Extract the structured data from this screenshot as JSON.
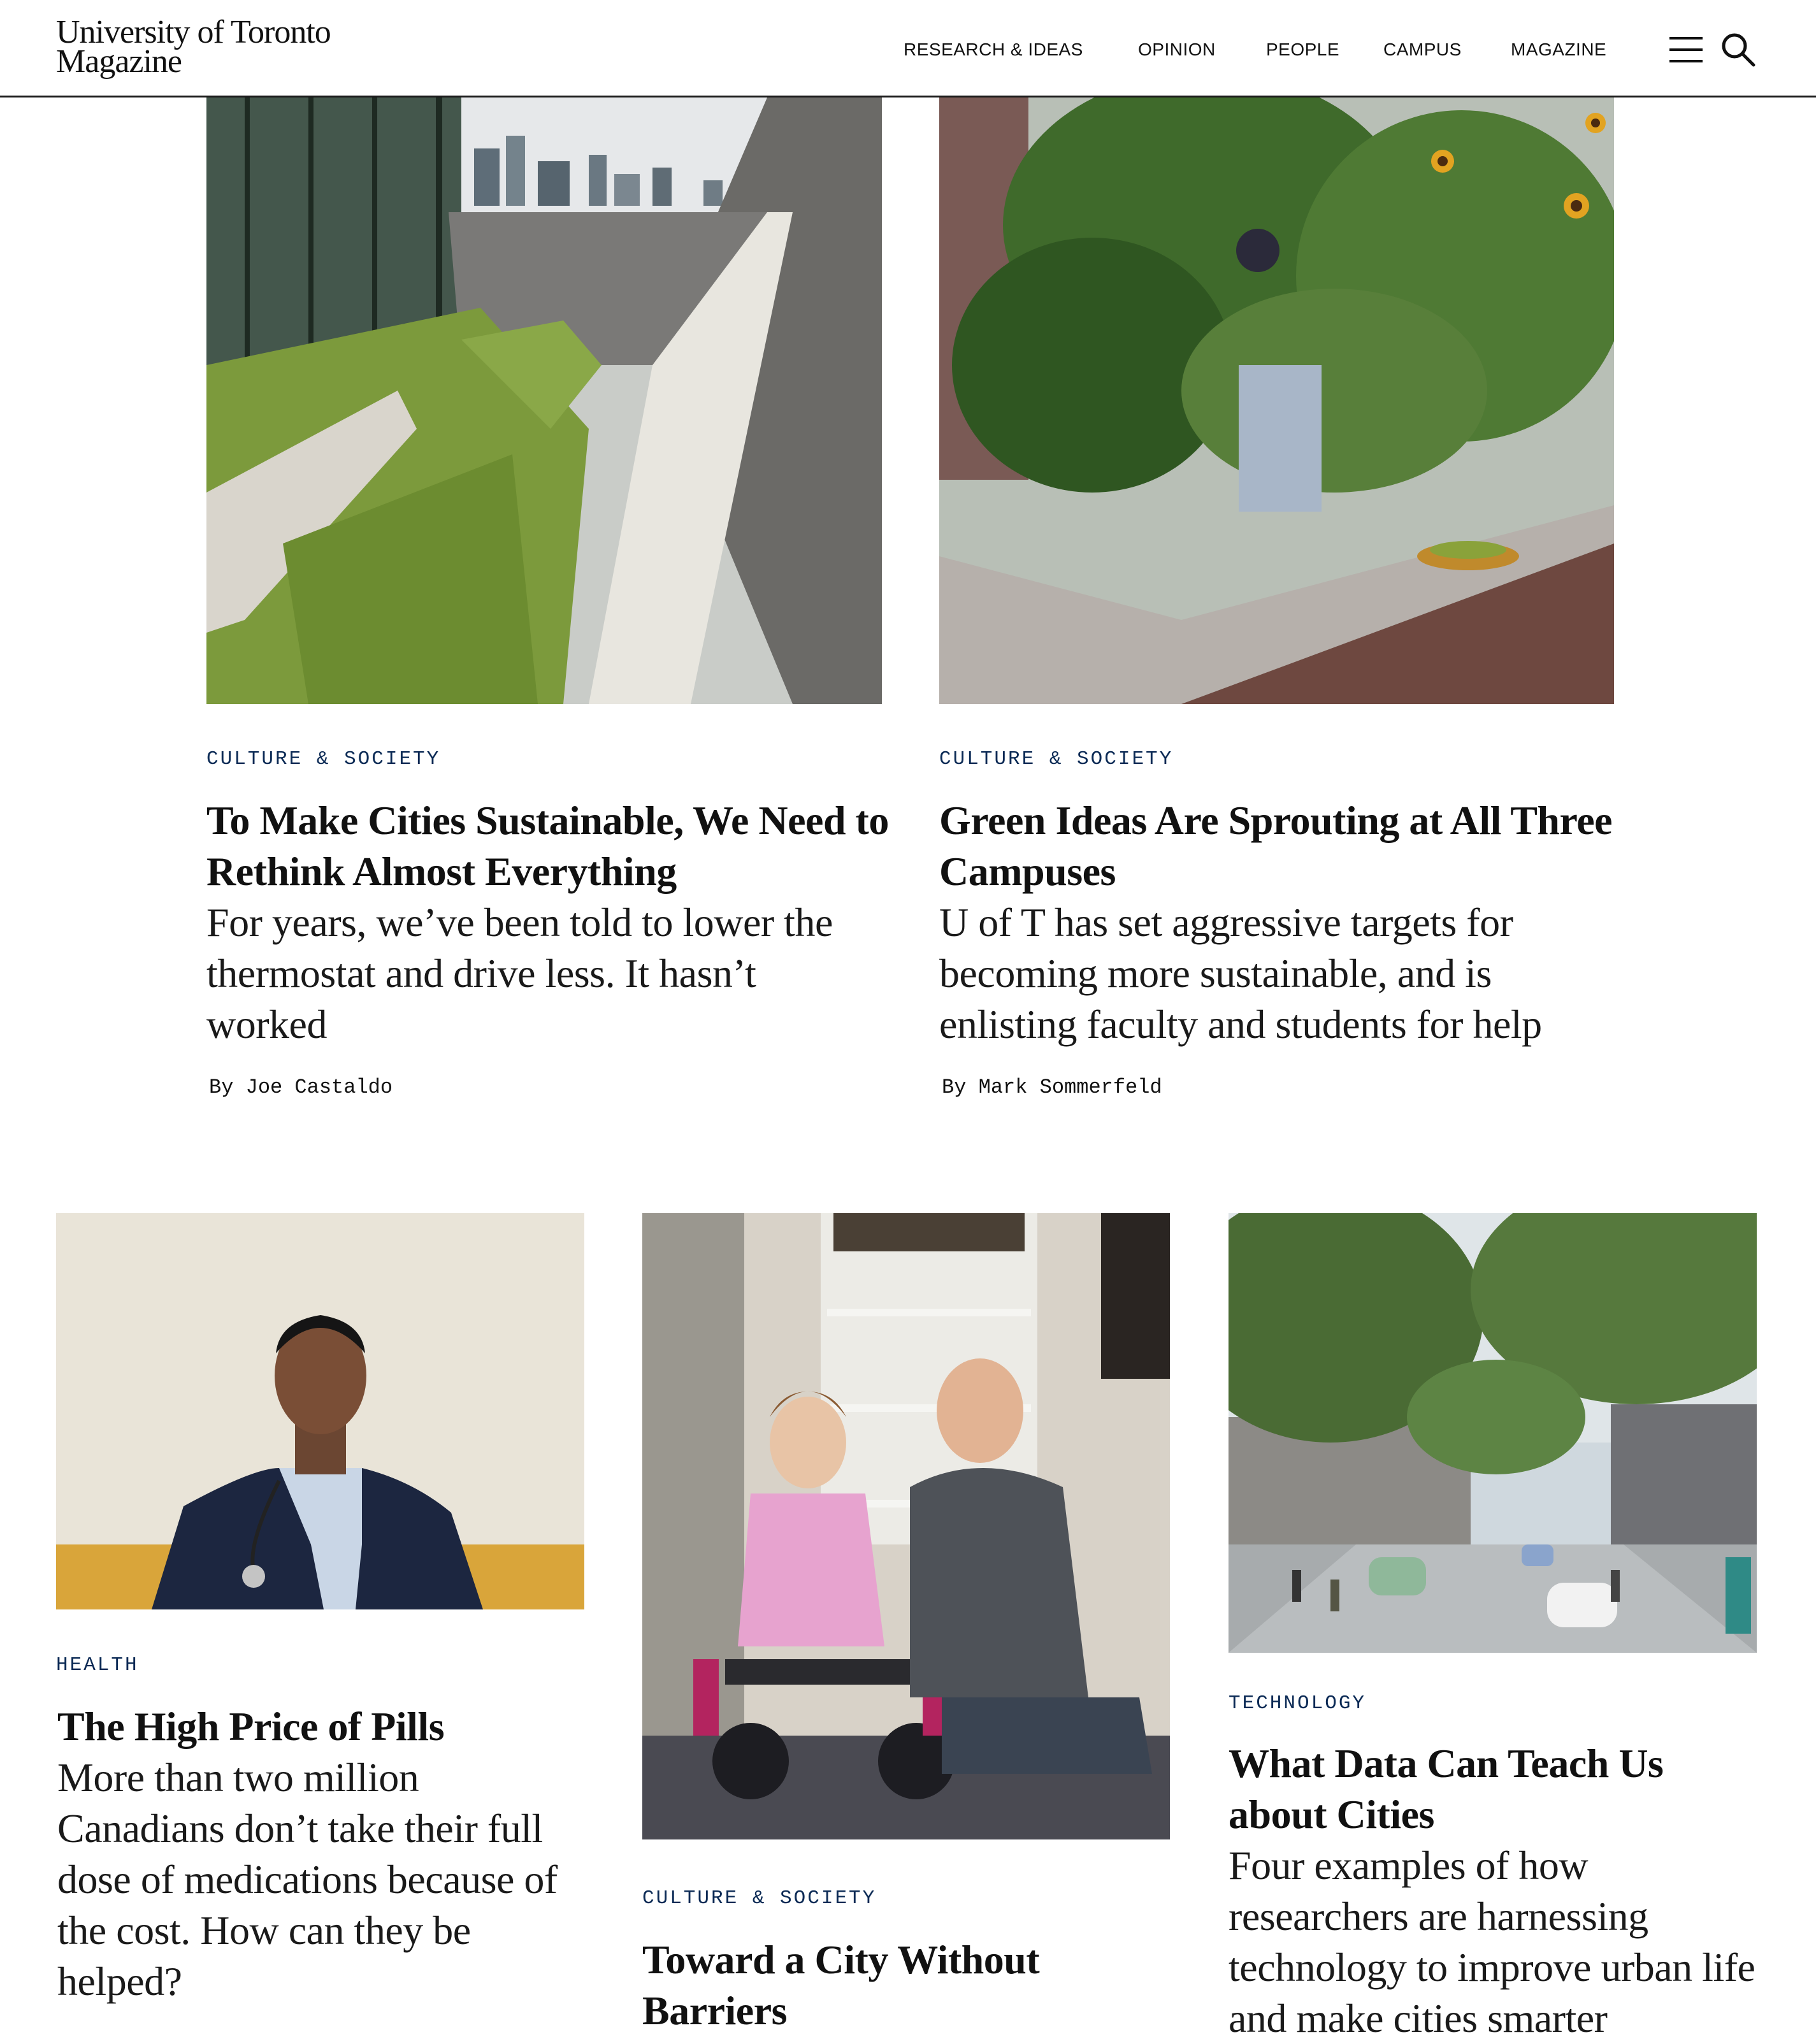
{
  "site": {
    "logo_line1": "University of Toronto",
    "logo_line2": "Magazine"
  },
  "nav": {
    "items": [
      {
        "label": "RESEARCH & IDEAS"
      },
      {
        "label": "OPINION"
      },
      {
        "label": "PEOPLE"
      },
      {
        "label": "CAMPUS"
      },
      {
        "label": "MAGAZINE"
      }
    ],
    "menu_icon": "hamburger-menu-icon",
    "search_icon": "search-icon"
  },
  "articles": [
    {
      "category": "CULTURE & SOCIETY",
      "title": "To Make Cities Sustainable, We Need to Rethink Almost Everything",
      "dek": "For years, we’ve been told to lower the thermostat and drive less. It hasn’t worked",
      "byline": "By Joe Castaldo",
      "image_icon": "green-roof-photo"
    },
    {
      "category": "CULTURE & SOCIETY",
      "title": "Green Ideas Are Sprouting at All Three Campuses",
      "dek": "U of T has set aggressive targets for becoming more sustainable, and is enlisting faculty and students for help",
      "byline": "By Mark Sommerfeld",
      "image_icon": "rooftop-garden-photo"
    },
    {
      "category": "HEALTH",
      "title": "The High Price of Pills",
      "dek": "More than two million Canadians don’t take their full dose of medications because of the cost. How can they be helped?",
      "image_icon": "doctor-portrait-photo"
    },
    {
      "category": "CULTURE & SOCIETY",
      "title": "Toward a City Without Barriers",
      "image_icon": "wheelchair-family-photo"
    },
    {
      "category": "TECHNOLOGY",
      "title": "What Data Can Teach Us about Cities",
      "dek": "Four examples of how researchers are harnessing technology to improve urban life and make cities smarter",
      "image_icon": "smart-city-street-photo"
    }
  ],
  "colors": {
    "kicker": "#0b2a55",
    "text": "#111111",
    "header_rule": "#1a1a1a"
  }
}
